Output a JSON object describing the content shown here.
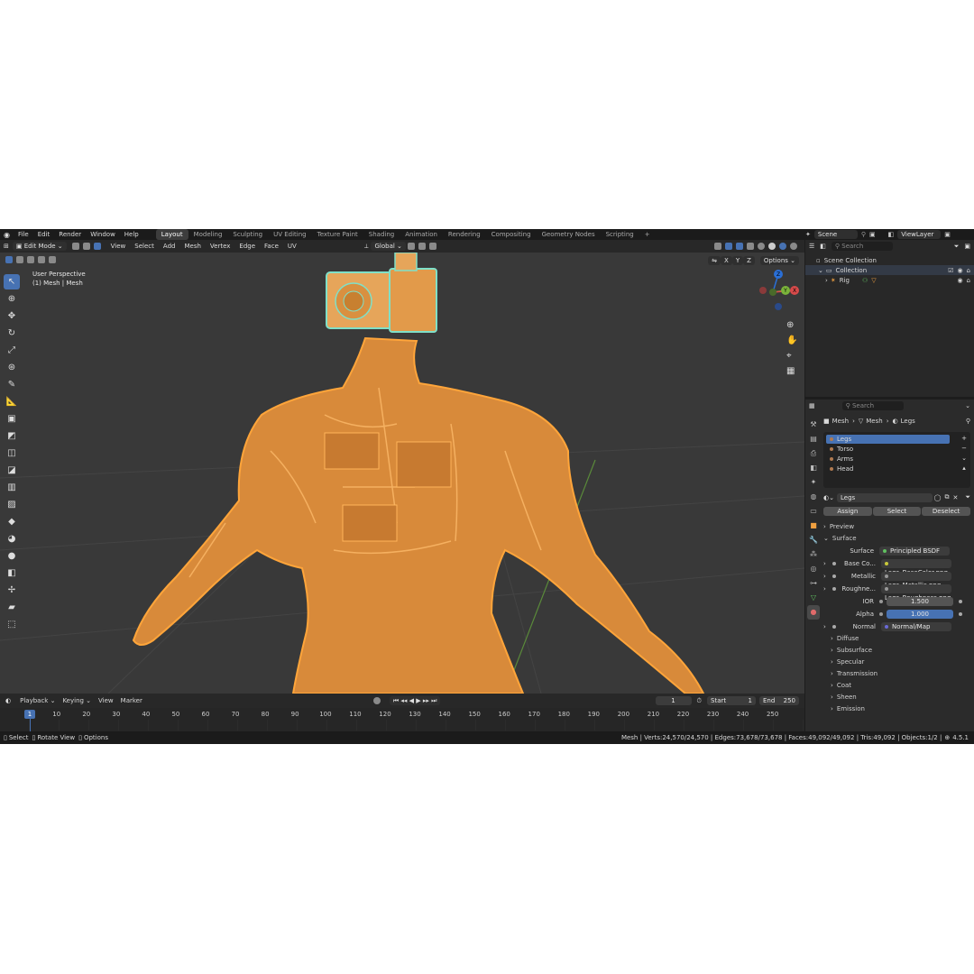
{
  "menu": {
    "items": [
      "File",
      "Edit",
      "Render",
      "Window",
      "Help"
    ],
    "workspaces": [
      "Layout",
      "Modeling",
      "Sculpting",
      "UV Editing",
      "Texture Paint",
      "Shading",
      "Animation",
      "Rendering",
      "Compositing",
      "Geometry Nodes",
      "Scripting"
    ],
    "active_workspace": "Layout",
    "add_tab": "+",
    "scene": "Scene",
    "view_layer": "ViewLayer"
  },
  "viewport_header": {
    "mode": "Edit Mode",
    "menus": [
      "View",
      "Select",
      "Add",
      "Mesh",
      "Vertex",
      "Edge",
      "Face",
      "UV"
    ],
    "orientation": "Global",
    "options": "Options",
    "axes": [
      "X",
      "Y",
      "Z"
    ]
  },
  "viewport": {
    "perspective": "User Perspective",
    "object_info": "(1) Mesh | Mesh"
  },
  "gizmo": {
    "z": "Z",
    "y": "Y",
    "x": "X"
  },
  "outliner": {
    "search_placeholder": "Search",
    "scene_collection": "Scene Collection",
    "collection": "Collection",
    "rig": "Rig"
  },
  "properties": {
    "search_placeholder": "Search",
    "breadcrumb": [
      "Mesh",
      "Mesh",
      "Legs"
    ],
    "materials": [
      "Legs",
      "Torso",
      "Arms",
      "Head"
    ],
    "selected_material": "Legs",
    "material_name": "Legs",
    "assign": "Assign",
    "select": "Select",
    "deselect": "Deselect",
    "preview": "Preview",
    "surface_section": "Surface",
    "surface_label": "Surface",
    "surface_value": "Principled BSDF",
    "inputs": [
      {
        "label": "Base Co...",
        "value": "Legs_BaseColor.png"
      },
      {
        "label": "Metallic",
        "value": "Legs_Metallic.png"
      },
      {
        "label": "Roughne...",
        "value": "Legs_Roughness.png"
      }
    ],
    "ior_label": "IOR",
    "ior_value": "1.500",
    "alpha_label": "Alpha",
    "alpha_value": "1.000",
    "normal_label": "Normal",
    "normal_value": "Normal/Map",
    "subsections": [
      "Diffuse",
      "Subsurface",
      "Specular",
      "Transmission",
      "Coat",
      "Sheen",
      "Emission"
    ]
  },
  "timeline": {
    "menus": [
      "Playback",
      "Keying",
      "View",
      "Marker"
    ],
    "current_frame": "1",
    "start_label": "Start",
    "start_value": "1",
    "end_label": "End",
    "end_value": "250",
    "ticks": [
      "1",
      "10",
      "20",
      "30",
      "40",
      "50",
      "60",
      "70",
      "80",
      "90",
      "100",
      "110",
      "120",
      "130",
      "140",
      "150",
      "160",
      "170",
      "180",
      "190",
      "200",
      "210",
      "220",
      "230",
      "240",
      "250"
    ]
  },
  "status": {
    "left": [
      "Select",
      "Rotate View",
      "Options"
    ],
    "stats": "Mesh | Verts:24,570/24,570 | Edges:73,678/73,678 | Faces:49,092/49,092 | Tris:49,092 | Objects:1/2 |",
    "version": "4.5.1"
  },
  "colors": {
    "accent": "#4772b3",
    "mesh_orange": "#f5a032",
    "mesh_cyan": "#7fe0c8",
    "viewport_bg": "#393939"
  }
}
